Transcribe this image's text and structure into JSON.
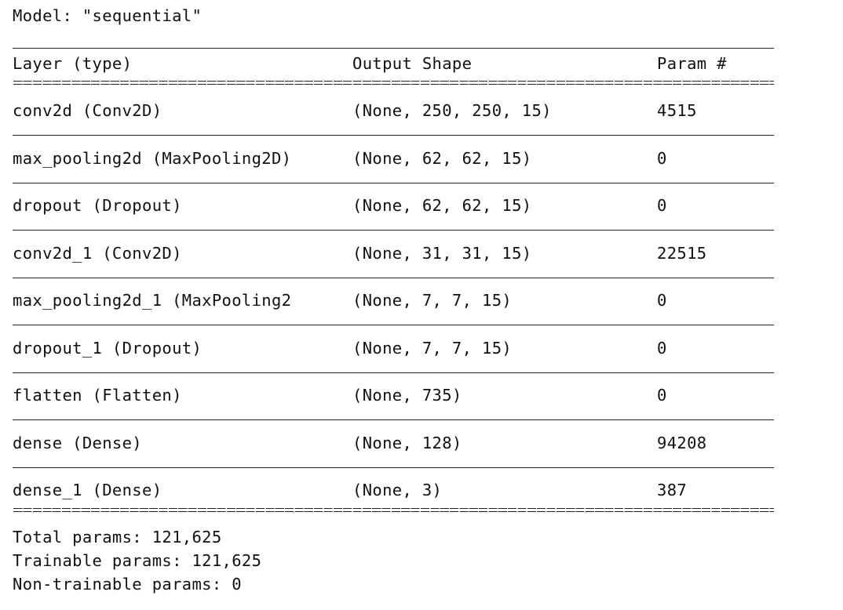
{
  "model_title": "Model: \"sequential\"",
  "header": {
    "layer": "Layer (type)",
    "output_shape": "Output Shape",
    "params": "Param #"
  },
  "layers": [
    {
      "layer": "conv2d (Conv2D)",
      "output_shape": "(None, 250, 250, 15)",
      "params": "4515"
    },
    {
      "layer": "max_pooling2d (MaxPooling2D)",
      "output_shape": "(None, 62, 62, 15)",
      "params": "0"
    },
    {
      "layer": "dropout (Dropout)",
      "output_shape": "(None, 62, 62, 15)",
      "params": "0"
    },
    {
      "layer": "conv2d_1 (Conv2D)",
      "output_shape": "(None, 31, 31, 15)",
      "params": "22515"
    },
    {
      "layer": "max_pooling2d_1 (MaxPooling2",
      "output_shape": "(None, 7, 7, 15)",
      "params": "0"
    },
    {
      "layer": "dropout_1 (Dropout)",
      "output_shape": "(None, 7, 7, 15)",
      "params": "0"
    },
    {
      "layer": "flatten (Flatten)",
      "output_shape": "(None, 735)",
      "params": "0"
    },
    {
      "layer": "dense (Dense)",
      "output_shape": "(None, 128)",
      "params": "94208"
    },
    {
      "layer": "dense_1 (Dense)",
      "output_shape": "(None, 3)",
      "params": "387"
    }
  ],
  "totals": {
    "total": "Total params: 121,625",
    "trainable": "Trainable params: 121,625",
    "non_trainable": "Non-trainable params: 0"
  },
  "colors": {
    "text": "#111111",
    "background": "#ffffff"
  }
}
